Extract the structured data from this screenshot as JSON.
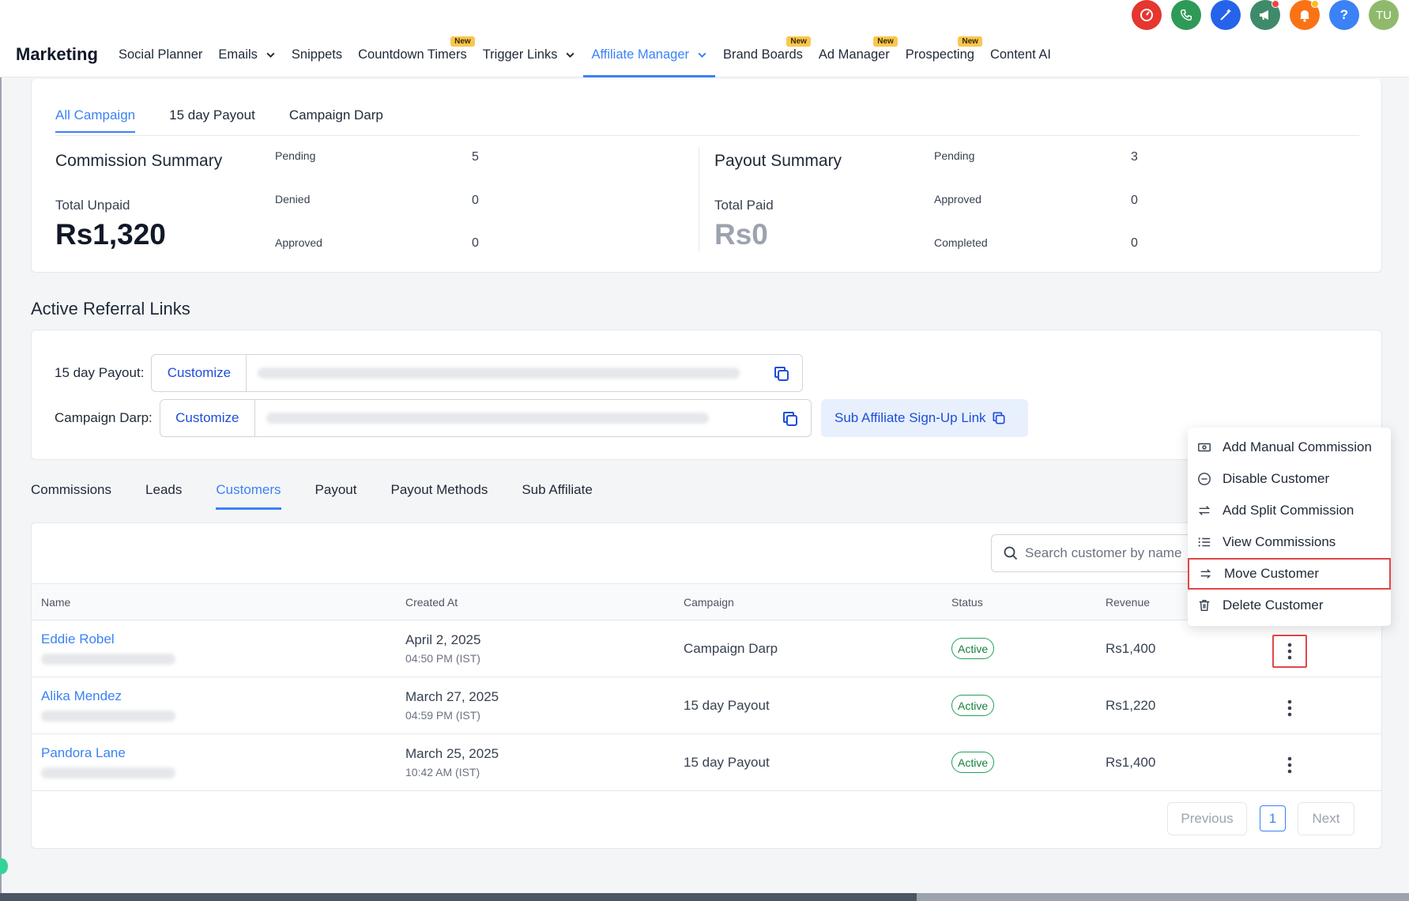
{
  "app": {
    "brand": "Marketing"
  },
  "nav": {
    "items": [
      {
        "label": "Social Planner",
        "new": false,
        "dropdown": false,
        "active": false
      },
      {
        "label": "Emails",
        "new": false,
        "dropdown": true,
        "active": false
      },
      {
        "label": "Snippets",
        "new": false,
        "dropdown": false,
        "active": false
      },
      {
        "label": "Countdown Timers",
        "new": true,
        "dropdown": false,
        "active": false
      },
      {
        "label": "Trigger Links",
        "new": false,
        "dropdown": true,
        "active": false
      },
      {
        "label": "Affiliate Manager",
        "new": false,
        "dropdown": true,
        "active": true
      },
      {
        "label": "Brand Boards",
        "new": true,
        "dropdown": false,
        "active": false
      },
      {
        "label": "Ad Manager",
        "new": true,
        "dropdown": false,
        "active": false
      },
      {
        "label": "Prospecting",
        "new": true,
        "dropdown": false,
        "active": false
      },
      {
        "label": "Content AI",
        "new": false,
        "dropdown": false,
        "active": false
      }
    ],
    "new_badge": "New"
  },
  "top_icons": [
    {
      "name": "dashboard-icon",
      "color": "#e5362f"
    },
    {
      "name": "phone-icon",
      "color": "#2f9a57"
    },
    {
      "name": "sparkle-icon",
      "color": "#2563eb"
    },
    {
      "name": "megaphone-icon",
      "color": "#3f8a6a"
    },
    {
      "name": "bell-icon",
      "color": "#f97316"
    },
    {
      "name": "help-icon",
      "color": "#3b82f6"
    },
    {
      "name": "avatar-icon",
      "color": "#8fba6c",
      "initials": "TU"
    }
  ],
  "summary": {
    "tabs": [
      "All Campaign",
      "15 day Payout",
      "Campaign Darp"
    ],
    "commission": {
      "title": "Commission Summary",
      "total_label": "Total Unpaid",
      "total_value": "Rs1,320",
      "stats": [
        {
          "label": "Pending",
          "value": "5"
        },
        {
          "label": "Denied",
          "value": "0"
        },
        {
          "label": "Approved",
          "value": "0"
        }
      ]
    },
    "payout": {
      "title": "Payout Summary",
      "total_label": "Total Paid",
      "total_value": "Rs0",
      "stats": [
        {
          "label": "Pending",
          "value": "3"
        },
        {
          "label": "Approved",
          "value": "0"
        },
        {
          "label": "Completed",
          "value": "0"
        }
      ]
    }
  },
  "referral": {
    "title": "Active Referral Links",
    "links": [
      {
        "label": "15 day Payout:",
        "customize": "Customize"
      },
      {
        "label": "Campaign Darp:",
        "customize": "Customize"
      }
    ],
    "sub_affiliate_label": "Sub Affiliate Sign-Up Link"
  },
  "detail_tabs": [
    "Commissions",
    "Leads",
    "Customers",
    "Payout",
    "Payout Methods",
    "Sub Affiliate"
  ],
  "active_detail_tab": "Customers",
  "search": {
    "placeholder": "Search customer by name"
  },
  "table": {
    "columns": [
      "Name",
      "Created At",
      "Campaign",
      "Status",
      "Revenue"
    ],
    "rows": [
      {
        "name": "Eddie Robel",
        "date": "April 2, 2025",
        "time": "04:50 PM (IST)",
        "campaign": "Campaign Darp",
        "status": "Active",
        "revenue": "Rs1,400"
      },
      {
        "name": "Alika Mendez",
        "date": "March 27, 2025",
        "time": "04:59 PM (IST)",
        "campaign": "15 day Payout",
        "status": "Active",
        "revenue": "Rs1,220"
      },
      {
        "name": "Pandora Lane",
        "date": "March 25, 2025",
        "time": "10:42 AM (IST)",
        "campaign": "15 day Payout",
        "status": "Active",
        "revenue": "Rs1,400"
      }
    ]
  },
  "pagination": {
    "previous": "Previous",
    "page": "1",
    "next": "Next"
  },
  "menu": {
    "items": [
      {
        "label": "Add Manual Commission",
        "icon": "money-icon"
      },
      {
        "label": "Disable Customer",
        "icon": "minus-circle-icon"
      },
      {
        "label": "Add Split Commission",
        "icon": "swap-arrows-icon"
      },
      {
        "label": "View Commissions",
        "icon": "list-icon"
      },
      {
        "label": "Move Customer",
        "icon": "move-arrows-icon"
      },
      {
        "label": "Delete Customer",
        "icon": "trash-icon"
      }
    ]
  }
}
